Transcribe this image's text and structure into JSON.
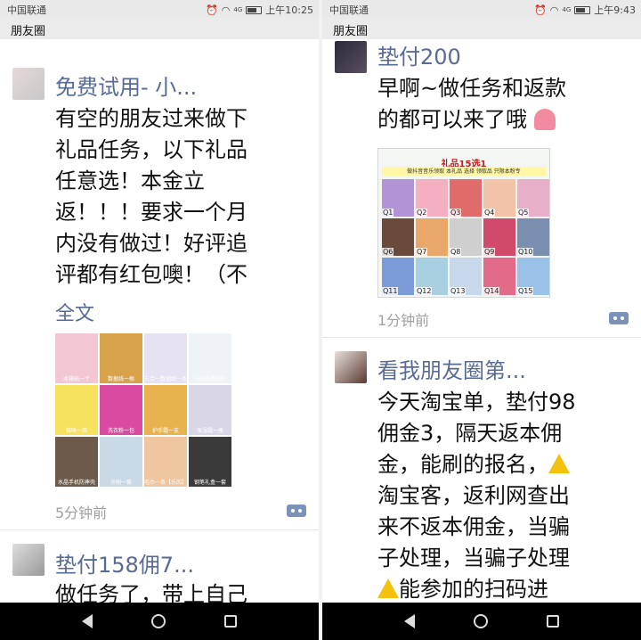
{
  "left": {
    "status": {
      "carrier": "中国联通",
      "signal": "4G",
      "time": "上午10:25"
    },
    "title": "朋友圈",
    "posts": [
      {
        "name": "免费试用- 小...",
        "lines": [
          "有空的朋友过来做下",
          "礼品任务，以下礼品",
          "任意选！本金立",
          "返！！！要求一个月",
          "内没有做过！好评追",
          "评都有红包噢！（不"
        ],
        "full_text_link": "全文",
        "time": "5分钟前",
        "images": [
          {
            "label": "冰箱贴一个",
            "color": "#f2c7d3"
          },
          {
            "label": "数据线一根",
            "color": "#d8a24a"
          },
          {
            "label": "三合一数据线一条",
            "color": "#e7e2f2"
          },
          {
            "label": "小白鞋清洗剂",
            "color": "#eef3f8"
          },
          {
            "label": "猫咪一双",
            "color": "#f6e25e"
          },
          {
            "label": "洗衣粉一包",
            "color": "#d94aa0"
          },
          {
            "label": "护手霜一支",
            "color": "#e8b34f"
          },
          {
            "label": "保湿霜一瓶",
            "color": "#d9d6e8"
          },
          {
            "label": "水晶手机防摔壳",
            "color": "#6d5a4a"
          },
          {
            "label": "牙刷一套",
            "color": "#c9d9e6"
          },
          {
            "label": "毛巾一条【乐的】",
            "color": "#f0c6a0"
          },
          {
            "label": "钢笔礼盒一套",
            "color": "#3a3a3a"
          }
        ]
      },
      {
        "name": "垫付158佣7...",
        "lines": [
          "做任务了，带上自己"
        ]
      }
    ]
  },
  "right": {
    "status": {
      "carrier": "中国联通",
      "signal": "4G",
      "time": "上午9:43"
    },
    "title": "朋友圈",
    "posts": [
      {
        "name": "垫付200",
        "lines": [
          "早啊~做任务和返款",
          "的都可以来了哦"
        ],
        "time": "1分钟前",
        "gift_image": {
          "title": "礼品15选1",
          "subtitle": "做抖音音乐领取  本礼品 选择 领取品  只限本粉专",
          "items": [
            {
              "label": "Q1",
              "color": "#b294d6"
            },
            {
              "label": "Q2",
              "color": "#f4b0c0"
            },
            {
              "label": "Q3",
              "color": "#e06b6b"
            },
            {
              "label": "Q4",
              "color": "#f2c3a8"
            },
            {
              "label": "Q5",
              "color": "#e7b0c8"
            },
            {
              "label": "Q6",
              "color": "#6a4a3a"
            },
            {
              "label": "Q7",
              "color": "#e9a86a"
            },
            {
              "label": "Q8",
              "color": "#cfcfcf"
            },
            {
              "label": "Q9",
              "color": "#d24a6a"
            },
            {
              "label": "Q10",
              "color": "#7a8fb0"
            },
            {
              "label": "Q11",
              "color": "#7b9cd8"
            },
            {
              "label": "Q12",
              "color": "#a8d0e0"
            },
            {
              "label": "Q13",
              "color": "#c6d8ea"
            },
            {
              "label": "Q14",
              "color": "#e46a8a"
            },
            {
              "label": "Q15",
              "color": "#9ac2e8"
            }
          ]
        }
      },
      {
        "name": "看我朋友圈第...",
        "lines": [
          "今天淘宝单，垫付98",
          "佣金3，隔天返本佣",
          "金，能刷的报名，",
          "淘宝客，返利网查出",
          "来不返本佣金，当骗",
          "子处理，当骗子处理",
          "能参加的扫码进"
        ]
      }
    ]
  },
  "colors": {
    "name_blue": "#576b95",
    "time_gray": "#a0a0a0",
    "warning_yellow": "#f4c20d"
  }
}
